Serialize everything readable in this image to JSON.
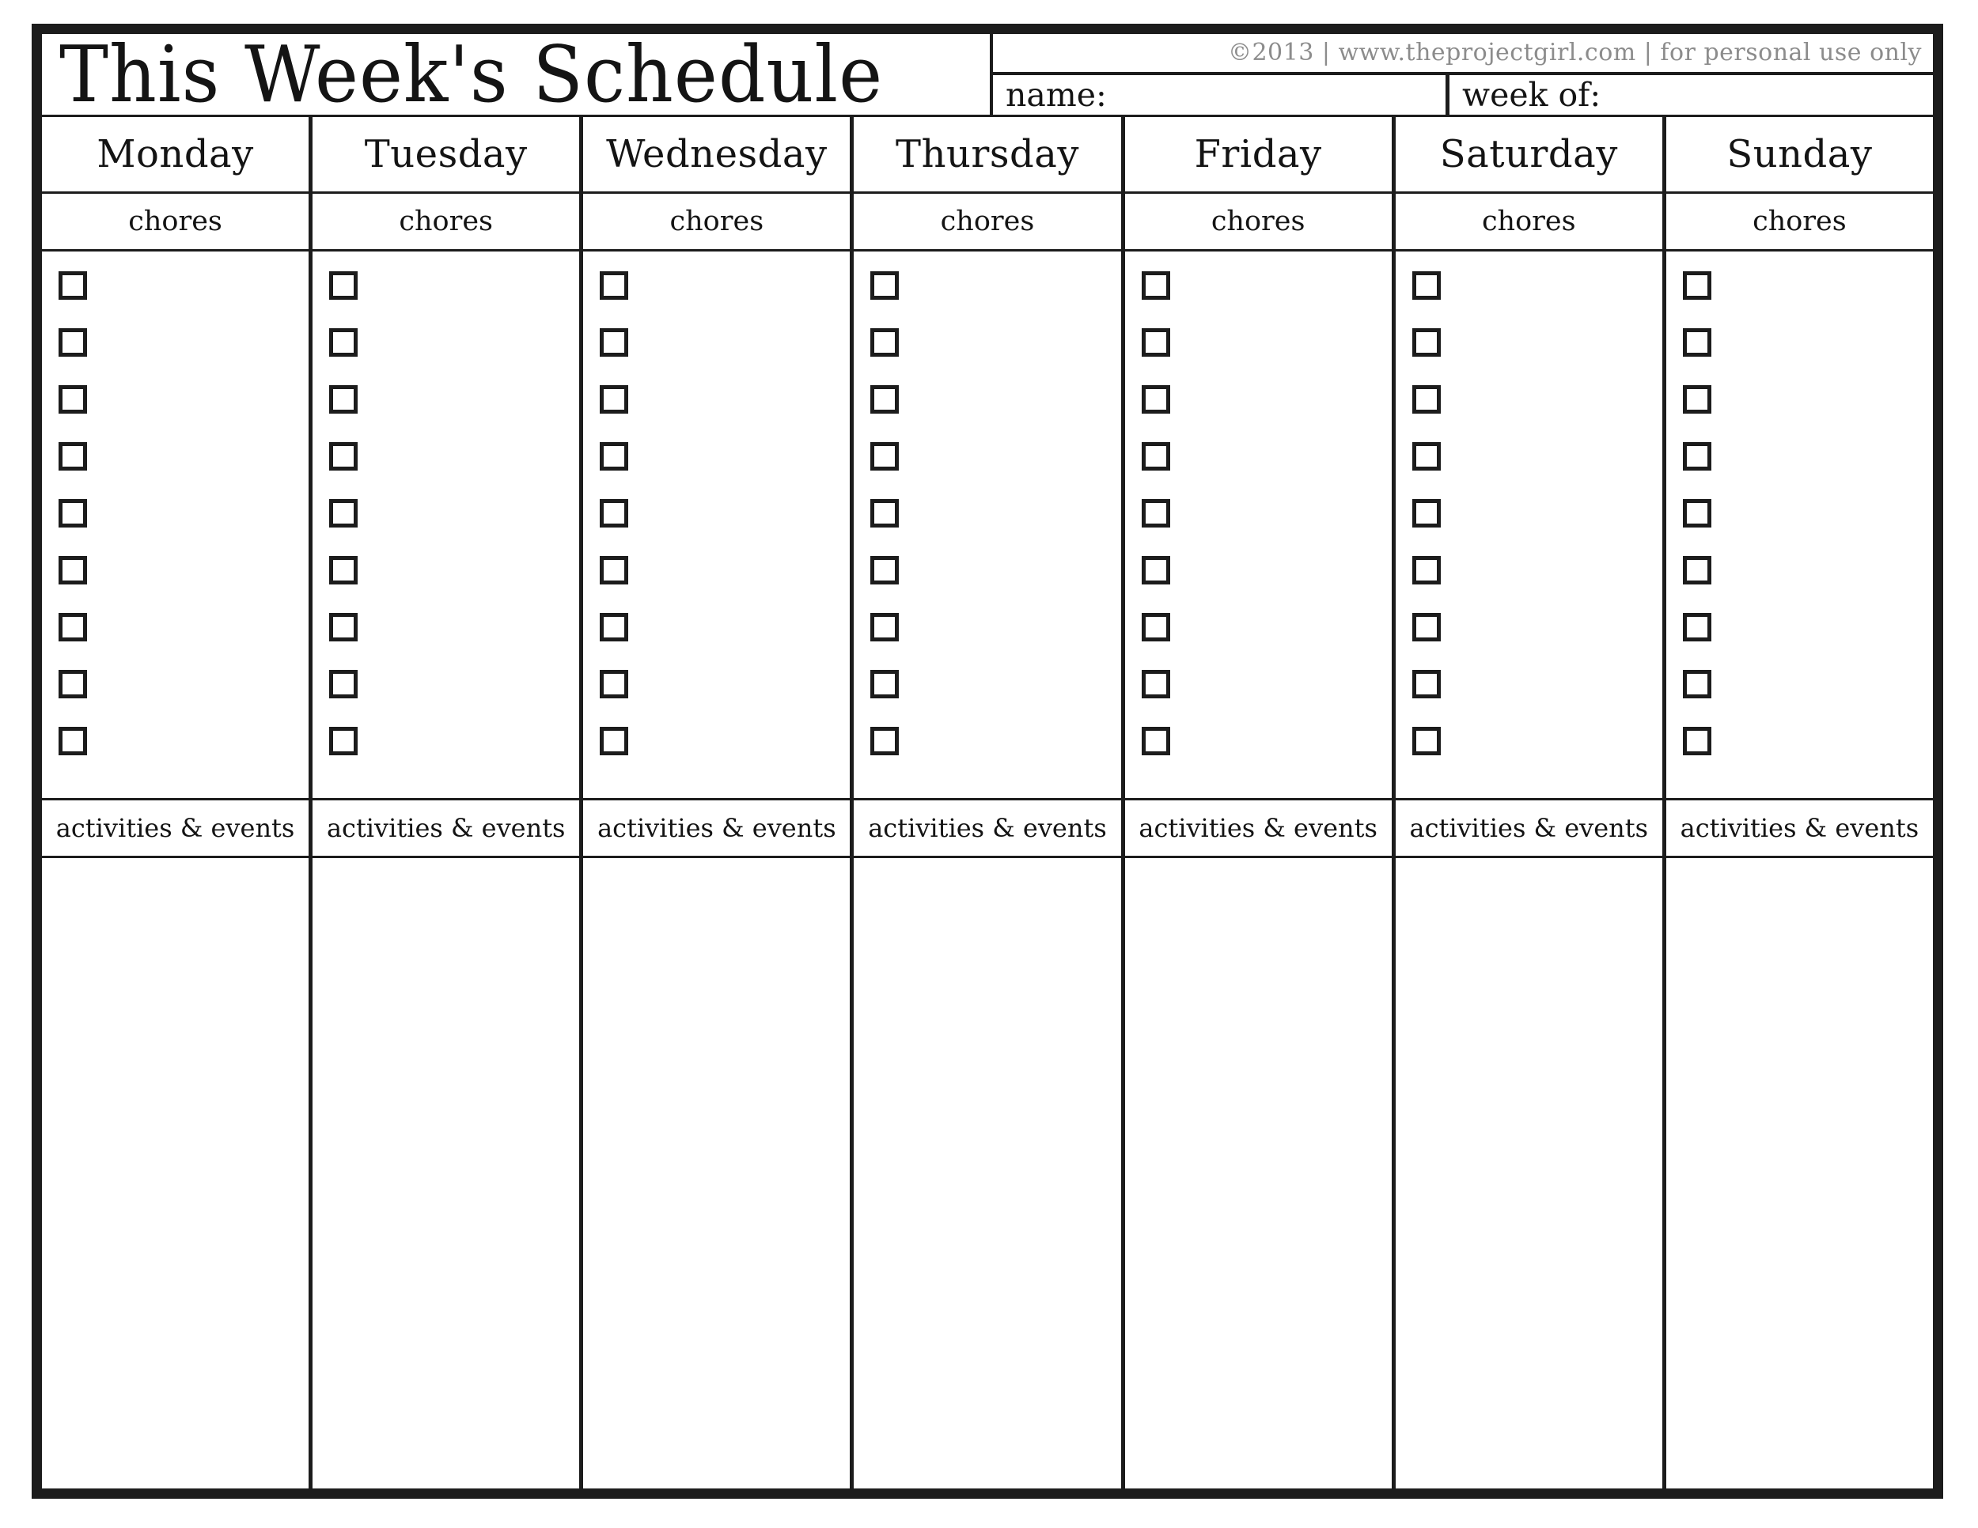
{
  "document": {
    "title": "This Week's Schedule",
    "copyright": "©2013 | www.theprojectgirl.com | for personal use only",
    "fields": {
      "name_label": "name:",
      "name_value": "",
      "week_of_label": "week of:",
      "week_of_value": ""
    }
  },
  "colors": {
    "border": "#1c1c1c",
    "text": "#141414",
    "copyright_text": "#8c8c8c",
    "page_background": "#ffffff"
  },
  "section_labels": {
    "chores": "chores",
    "activities": "activities & events"
  },
  "checkbox_count_per_day": 9,
  "days": [
    {
      "label": "Monday",
      "chores_label": "chores",
      "activities_label": "activities & events",
      "checkboxes": [
        false,
        false,
        false,
        false,
        false,
        false,
        false,
        false,
        false
      ],
      "notes": ""
    },
    {
      "label": "Tuesday",
      "chores_label": "chores",
      "activities_label": "activities & events",
      "checkboxes": [
        false,
        false,
        false,
        false,
        false,
        false,
        false,
        false,
        false
      ],
      "notes": ""
    },
    {
      "label": "Wednesday",
      "chores_label": "chores",
      "activities_label": "activities & events",
      "checkboxes": [
        false,
        false,
        false,
        false,
        false,
        false,
        false,
        false,
        false
      ],
      "notes": ""
    },
    {
      "label": "Thursday",
      "chores_label": "chores",
      "activities_label": "activities & events",
      "checkboxes": [
        false,
        false,
        false,
        false,
        false,
        false,
        false,
        false,
        false
      ],
      "notes": ""
    },
    {
      "label": "Friday",
      "chores_label": "chores",
      "activities_label": "activities & events",
      "checkboxes": [
        false,
        false,
        false,
        false,
        false,
        false,
        false,
        false,
        false
      ],
      "notes": ""
    },
    {
      "label": "Saturday",
      "chores_label": "chores",
      "activities_label": "activities & events",
      "checkboxes": [
        false,
        false,
        false,
        false,
        false,
        false,
        false,
        false,
        false
      ],
      "notes": ""
    },
    {
      "label": "Sunday",
      "chores_label": "chores",
      "activities_label": "activities & events",
      "checkboxes": [
        false,
        false,
        false,
        false,
        false,
        false,
        false,
        false,
        false
      ],
      "notes": ""
    }
  ]
}
